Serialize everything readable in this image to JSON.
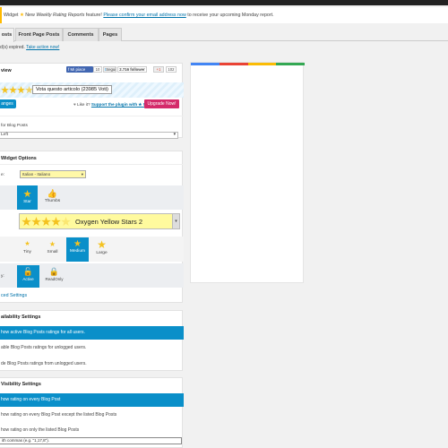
{
  "notice": {
    "prefix": "Widget",
    "text1": "New",
    "feature": "Weekly Rating Reports",
    "text2": "feature!",
    "link": "Please confirm your email address now",
    "text3": "to receive your upcoming Monday report."
  },
  "tabs": [
    "osts",
    "Front Page Posts",
    "Comments",
    "Pages"
  ],
  "expired": {
    "text": "d(s) expired.",
    "link": "Take action now!"
  },
  "preview": {
    "title": "view",
    "social": {
      "fb": "Mi piace",
      "fb_count": "10",
      "tw": "Segui",
      "tw_count": "2.716 follower",
      "gplus": "+1",
      "gplus_count": "102"
    },
    "vote_text": "Vota questo articolo (23985 Voti)",
    "like_text": "Like it?",
    "support_link": "Support the plugin with ★ 5 Stars",
    "changes_btn": "anges",
    "upgrade_btn": "Upgrade Now!"
  },
  "align": {
    "label": "for Blog Posts",
    "value": "Left"
  },
  "widget": {
    "title": "Widget Options",
    "lang_label": "e:",
    "lang_value": "Italian - Italiano",
    "types": [
      "Star",
      "Thumbs"
    ],
    "theme_value": "Oxygen Yellow Stars 2",
    "sizes": [
      "Tiny",
      "Small",
      "Medium",
      "Large"
    ],
    "modes_label": "y:",
    "modes": [
      "Active",
      "ReadOnly"
    ],
    "advanced_link": "ced Settings"
  },
  "availability": {
    "title": "ailability Settings",
    "rows": [
      "how active Blog Posts ratings for all users.",
      "able Blog Posts ratings for unlogged users.",
      "de Blog Posts ratings from unlogged users."
    ]
  },
  "visibility": {
    "title": "Visibility Settings",
    "rows": [
      "how rating on every Blog Post",
      "how rating on every Blog Post except the listed Blog Posts",
      "how rating on only the listed Blog Posts"
    ],
    "input_placeholder": "ith commas (e.g. \"1,17,8\")."
  },
  "colors": {
    "accent": "#0a8fc9",
    "google": [
      "#4285f4",
      "#ea4335",
      "#fbbc05",
      "#34a853"
    ]
  }
}
